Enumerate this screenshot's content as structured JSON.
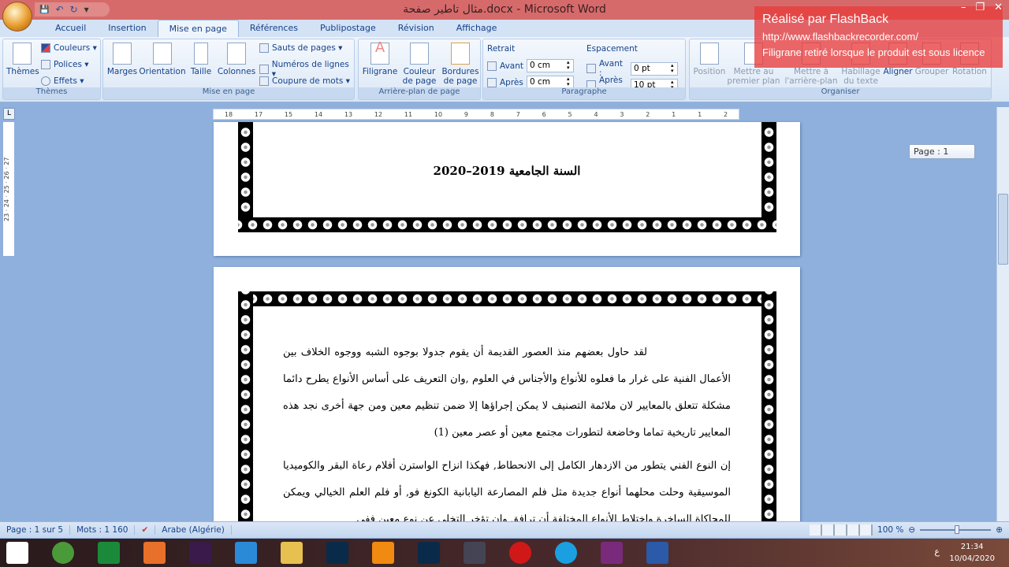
{
  "window": {
    "title": "مثال تاطير صفحة.docx - Microsoft Word",
    "minimize": "–",
    "restore": "❐",
    "close": "✕"
  },
  "qat": {
    "save": "💾",
    "undo": "↶",
    "redo": "↻",
    "customize": "▾"
  },
  "tabs": [
    "Accueil",
    "Insertion",
    "Mise en page",
    "Références",
    "Publipostage",
    "Révision",
    "Affichage"
  ],
  "active_tab": "Mise en page",
  "ribbon": {
    "themes": {
      "label": "Thèmes",
      "themes_btn": "Thèmes",
      "colors": "Couleurs ▾",
      "fonts": "Polices ▾",
      "effects": "Effets ▾"
    },
    "page_setup": {
      "label": "Mise en page",
      "margins": "Marges",
      "orientation": "Orientation",
      "size": "Taille",
      "columns": "Colonnes",
      "breaks": "Sauts de pages ▾",
      "line_numbers": "Numéros de lignes ▾",
      "hyphenation": "Coupure de mots ▾"
    },
    "page_background": {
      "label": "Arrière-plan de page",
      "watermark": "Filigrane",
      "page_color": "Couleur de page ▾",
      "page_borders": "Bordures de page"
    },
    "paragraph": {
      "label": "Paragraphe",
      "indent": "Retrait",
      "spacing": "Espacement",
      "indent_before_label": "Avant",
      "indent_before": "0 cm",
      "indent_after_label": "Après",
      "indent_after": "0 cm",
      "space_before_label": "Avant :",
      "space_before": "0 pt",
      "space_after_label": "Après :",
      "space_after": "10 pt"
    },
    "arrange": {
      "label": "Organiser",
      "position": "Position",
      "bring_forward": "Mettre au premier plan ▾",
      "send_backward": "Mettre à l'arrière-plan ▾",
      "wrap": "Habillage du texte ▾",
      "align": "Aligner",
      "group": "Grouper",
      "rotate": "Rotation"
    }
  },
  "watermark_overlay": {
    "line1": "Réalisé par FlashBack",
    "line2": "http://www.flashbackrecorder.com/",
    "line3": "Filigrane retiré lorsque le produit est sous licence"
  },
  "ruler": {
    "ticks": [
      "18",
      "17",
      "15",
      "14",
      "13",
      "12",
      "11",
      "10",
      "9",
      "8",
      "7",
      "6",
      "5",
      "4",
      "3",
      "2",
      "1",
      "1",
      "2"
    ],
    "vticks": "23 · 24 · 25 · 26 · 27"
  },
  "document": {
    "page1_text": "السنة الجامعية 2019–2020",
    "paragraph1": "لقد حاول بعضهم منذ العصور القديمة أن يقوم جدولا بوجوه الشبه ووجوه الخلاف بين الأعمال الفنية على غرار ما فعلوه للأنواع والأجناس في العلوم ,وان التعريف على أساس الأنواع يطرح دائما مشكلة تتعلق بالمعايير لان ملائمة التصنيف لا يمكن إجراؤها إلا ضمن تنظيم معين ومن جهة أخرى نجد هذه المعايير تاريخية تماما وخاضعة لتطورات مجتمع معين أو عصر معين (1)",
    "paragraph2": "إن النوع الفني يتطور من الازدهار الكامل إلى الانحطاط, فهكذا انزاح الواسترن أفلام رعاة البقر والكوميديا الموسيقية وحلت محلهما أنواع جديدة مثل فلم المصارعة اليابانية الكونغ فو, أو فلم العلم الخيالي ويمكن للمحاكاة الساخرة واختلاط الأنواع المختلفة أن ترافق وان تؤخر التخلي عن نوع معين ففي"
  },
  "page_tooltip": "Page : 1",
  "status": {
    "page": "Page : 1 sur 5",
    "words": "Mots : 1 160",
    "language": "Arabe (Algérie)",
    "zoom": "100 %",
    "zoom_level_percent": 100
  },
  "taskbar": {
    "icons": [
      "windows-start",
      "chrome",
      "store",
      "firefox",
      "premiere",
      "internet-explorer",
      "file-explorer",
      "photoshop",
      "vlc",
      "photoshop",
      "notebook",
      "opera",
      "skype",
      "flashback-recorder",
      "word"
    ],
    "time": "21:34",
    "date": "10/04/2020",
    "lang": "ع"
  },
  "colors": {
    "titlebar": "#d66a6b",
    "ribbon_text": "#15428b",
    "watermark": "#e83c3c",
    "workspace": "#8fb0dc"
  }
}
